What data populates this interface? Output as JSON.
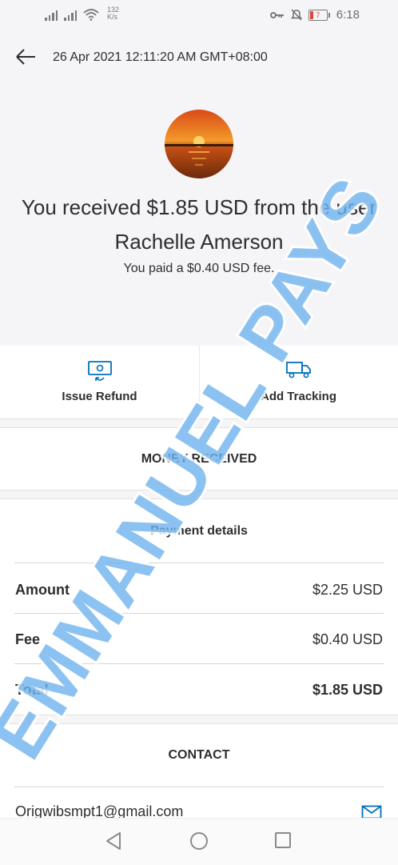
{
  "status_bar": {
    "net_speed_value": "132",
    "net_speed_unit": "K/s",
    "battery_level": "7",
    "time": "6:18",
    "icons": [
      "signal-icon",
      "signal-icon",
      "wifi-icon",
      "key-icon",
      "mute-icon",
      "battery-icon"
    ]
  },
  "header": {
    "date": "26 Apr 2021 12:11:20 AM GMT+08:00",
    "back_icon": "back-arrow-icon"
  },
  "summary": {
    "headline": "You received $1.85 USD from the user Rachelle Amerson",
    "fee_note": "You paid a $0.40 USD fee."
  },
  "actions": [
    {
      "label": "Issue Refund",
      "icon": "refund-icon"
    },
    {
      "label": "Add Tracking",
      "icon": "truck-icon"
    }
  ],
  "status_label": "MONEY RECEIVED",
  "payment_details": {
    "title": "Payment details",
    "rows": [
      {
        "label": "Amount",
        "value": "$2.25 USD"
      },
      {
        "label": "Fee",
        "value": "$0.40 USD"
      },
      {
        "label": "Total",
        "value": "$1.85 USD"
      }
    ]
  },
  "contact": {
    "title": "CONTACT",
    "email": "Origwibsmpt1@gmail.com",
    "icon": "mail-icon"
  },
  "watermark": "EMMANUEL PAYS",
  "colors": {
    "accent": "#0070ba",
    "watermark": "#6fb3ee",
    "background_top": "#f5f5f7"
  }
}
